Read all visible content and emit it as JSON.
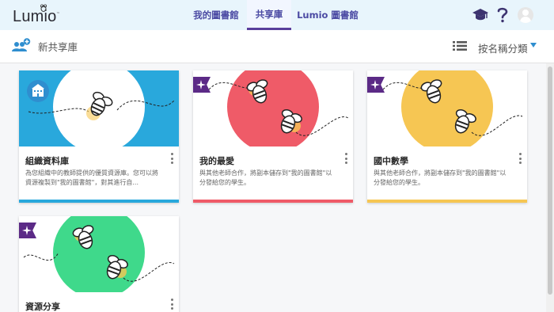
{
  "app": {
    "logo_text": "Lumio",
    "logo_tm": "™"
  },
  "nav": {
    "tabs": [
      {
        "label": "我的圖書館",
        "active": false
      },
      {
        "label": "共享庫",
        "active": true
      },
      {
        "label": "Lumio 圖書館",
        "active": false
      }
    ],
    "icons": [
      "graduation-cap-icon",
      "help-icon",
      "avatar-icon"
    ]
  },
  "toolbar": {
    "new_library_label": "新共享庫",
    "sort_label": "按名稱分類"
  },
  "cards": [
    {
      "title": "組織資料庫",
      "desc": "為您組織中的教師提供的優質資源庫。您可以將資源複製到\"我的圖書館\"，對其進行自...",
      "accent": "#29a8dc",
      "badge_icon": "school-building-icon"
    },
    {
      "title": "我的最愛",
      "desc": "與其他老師合作，將副本儲存到\"我的圖書館\"以分發給您的學生。",
      "accent": "#ef5b68",
      "badge_icon": "sparkle-icon"
    },
    {
      "title": "國中數學",
      "desc": "與其他老師合作，將副本儲存到\"我的圖書館\"以分發給您的學生。",
      "accent": "#f6c653",
      "badge_icon": "sparkle-icon"
    },
    {
      "title": "資源分享",
      "desc": "",
      "accent": "#3fd98b",
      "badge_icon": "sparkle-icon"
    }
  ]
}
